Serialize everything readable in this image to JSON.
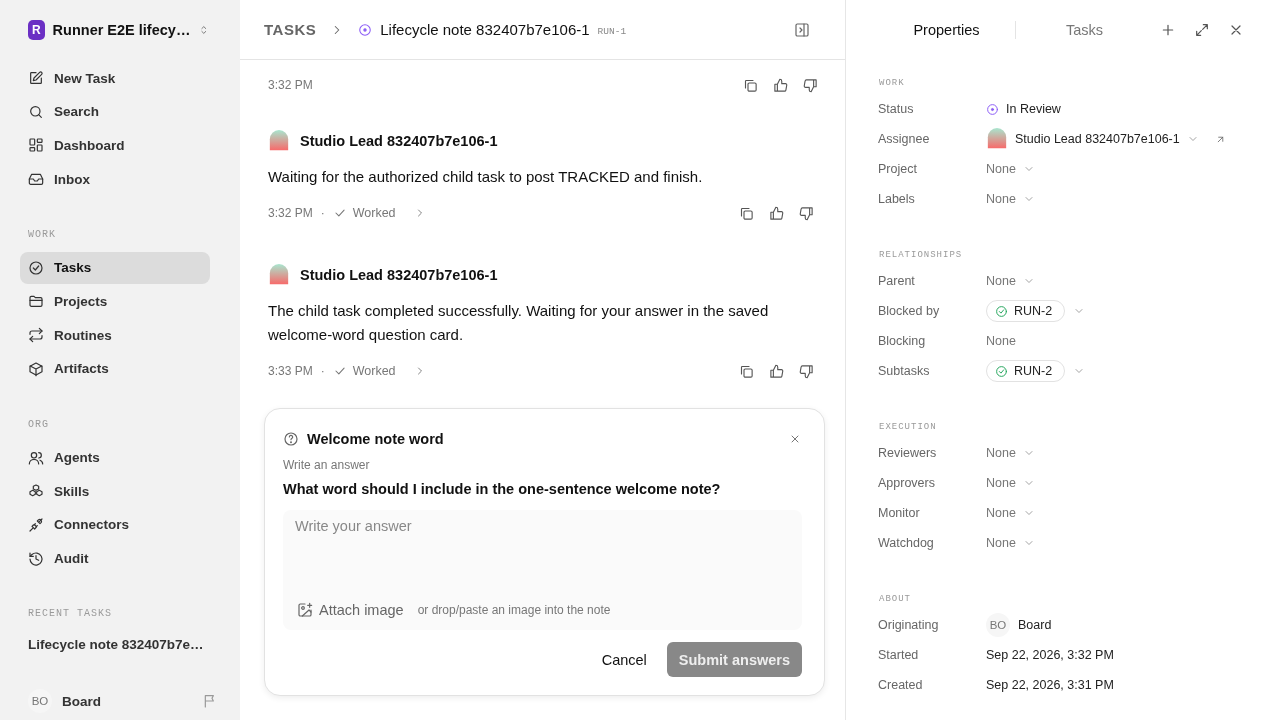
{
  "workspace": {
    "name": "Runner E2E lifecy…",
    "logo": "R"
  },
  "nav_sections": [
    {
      "items": [
        {
          "label": "New Task",
          "selected": false
        },
        {
          "label": "Search",
          "selected": false
        },
        {
          "label": "Dashboard",
          "selected": false
        },
        {
          "label": "Inbox",
          "selected": false
        }
      ]
    },
    {
      "title": "WORK",
      "items": [
        {
          "label": "Tasks",
          "selected": true
        },
        {
          "label": "Projects",
          "selected": false
        },
        {
          "label": "Routines",
          "selected": false
        },
        {
          "label": "Artifacts",
          "selected": false
        }
      ]
    },
    {
      "title": "ORG",
      "items": [
        {
          "label": "Agents",
          "selected": false
        },
        {
          "label": "Skills",
          "selected": false
        },
        {
          "label": "Connectors",
          "selected": false
        },
        {
          "label": "Audit",
          "selected": false
        }
      ]
    }
  ],
  "recent_tasks": {
    "title": "RECENT TASKS",
    "items": [
      "Lifecycle note 832407b7e…"
    ]
  },
  "user": {
    "initials": "BO",
    "name": "Board"
  },
  "header": {
    "breadcrumb": "TASKS",
    "title": "Lifecycle note 832407b7e106-1",
    "id": "RUN-1"
  },
  "messages": [
    {
      "time": "3:32 PM"
    },
    {
      "author": "Studio Lead 832407b7e106-1",
      "text": "Waiting for the authorized child task to post TRACKED and finish.",
      "time": "3:32 PM",
      "separator": "·",
      "status": "Worked"
    },
    {
      "author": "Studio Lead 832407b7e106-1",
      "text": "The child task completed successfully. Waiting for your answer in the saved welcome-word question card.",
      "time": "3:33 PM",
      "separator": "·",
      "status": "Worked"
    }
  ],
  "question_card": {
    "title": "Welcome note word",
    "label": "Write an answer",
    "question": "What word should I include in the one-sentence welcome note?",
    "placeholder": "Write your answer",
    "attach": "Attach image",
    "hint": "or drop/paste an image into the note",
    "cancel": "Cancel",
    "submit": "Submit answers",
    "submit_disabled": true
  },
  "panel": {
    "tabs": [
      {
        "label": "Properties",
        "selected": true
      },
      {
        "label": "Tasks",
        "selected": false
      }
    ],
    "sections": [
      {
        "title": "WORK",
        "rows": [
          {
            "label": "Status",
            "kind": "status",
            "value": "In Review"
          },
          {
            "label": "Assignee",
            "kind": "person",
            "value": "Studio Lead 832407b7e106-1"
          },
          {
            "label": "Project",
            "kind": "dropdown",
            "value": "None"
          },
          {
            "label": "Labels",
            "kind": "dropdown",
            "value": "None"
          }
        ]
      },
      {
        "title": "RELATIONSHIPS",
        "rows": [
          {
            "label": "Parent",
            "kind": "dropdown",
            "value": "None"
          },
          {
            "label": "Blocked by",
            "kind": "chip",
            "value": "RUN-2"
          },
          {
            "label": "Blocking",
            "kind": "plain",
            "value": "None"
          },
          {
            "label": "Subtasks",
            "kind": "chip",
            "value": "RUN-2"
          }
        ]
      },
      {
        "title": "EXECUTION",
        "rows": [
          {
            "label": "Reviewers",
            "kind": "dropdown",
            "value": "None"
          },
          {
            "label": "Approvers",
            "kind": "dropdown",
            "value": "None"
          },
          {
            "label": "Monitor",
            "kind": "dropdown",
            "value": "None"
          },
          {
            "label": "Watchdog",
            "kind": "dropdown",
            "value": "None"
          }
        ]
      },
      {
        "title": "ABOUT",
        "rows": [
          {
            "label": "Originating",
            "kind": "initials",
            "initials": "BO",
            "value": "Board"
          },
          {
            "label": "Started",
            "kind": "date",
            "value": "Sep 22, 2026, 3:32 PM"
          },
          {
            "label": "Created",
            "kind": "date",
            "value": "Sep 22, 2026, 3:31 PM"
          }
        ]
      }
    ]
  }
}
